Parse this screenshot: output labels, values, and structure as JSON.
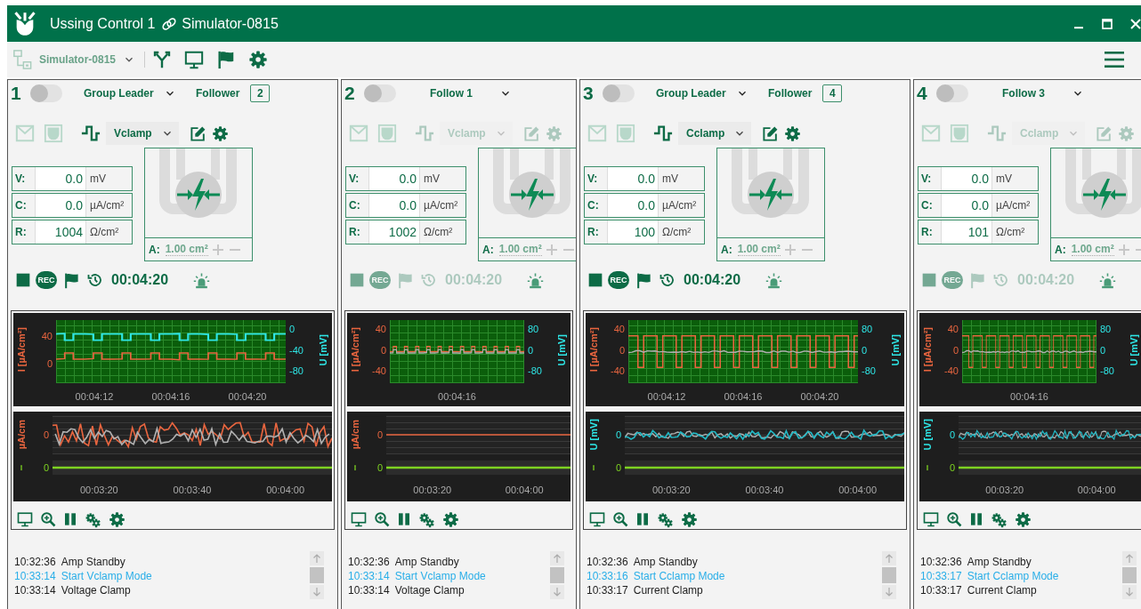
{
  "window": {
    "title": "Ussing Control 1",
    "device": "Simulator-0815"
  },
  "toolbar": {
    "device": "Simulator-0815"
  },
  "panels": [
    {
      "kind": "leader",
      "number": "1",
      "on": false,
      "group": "Group Leader",
      "follower_label": "Follower",
      "follower_count": "2",
      "controls_enabled": true,
      "mode": "Vclamp",
      "params": [
        {
          "label": "V:",
          "value": "0.0",
          "unit": "mV"
        },
        {
          "label": "C:",
          "value": "0.0",
          "unit": "µA/cm²"
        },
        {
          "label": "R:",
          "value": "1004",
          "unit": "Ω/cm²"
        }
      ],
      "area": {
        "label": "A:",
        "value": "1.00 cm²"
      },
      "rec_label": "REC",
      "time": "00:04:20",
      "trace_chart": {
        "kind": "voltage_steps",
        "left_label": "I [µA/cm²]",
        "left_ticks": [
          "40",
          "0"
        ],
        "right_label": "U [mV]",
        "right_ticks": [
          "0",
          "-40",
          "-80"
        ],
        "x_ticks": [
          "00:04:12",
          "00:04:16",
          "00:04:20"
        ]
      },
      "trend_chart": {
        "kind": "current_noise",
        "left_label": "µA/cm",
        "left_tick": "0",
        "lower_tick": "0",
        "x_ticks": [
          "00:03:20",
          "00:03:40",
          "00:04:00"
        ]
      },
      "log": [
        {
          "time": "10:32:36",
          "message": "Amp Standby",
          "color": "#1e1e1e"
        },
        {
          "time": "10:33:14",
          "message": "Start Vclamp Mode",
          "color": "#29aee8"
        },
        {
          "time": "10:33:14",
          "message": "Voltage Clamp",
          "color": "#1e1e1e"
        }
      ]
    },
    {
      "kind": "follower",
      "number": "2",
      "on": false,
      "group": "Follow 1",
      "controls_enabled": false,
      "mode": "Vclamp",
      "params": [
        {
          "label": "V:",
          "value": "0.0",
          "unit": "mV"
        },
        {
          "label": "C:",
          "value": "0.0",
          "unit": "µA/cm²"
        },
        {
          "label": "R:",
          "value": "1002",
          "unit": "Ω/cm²"
        }
      ],
      "area": {
        "label": "A:",
        "value": "1.00 cm²"
      },
      "rec_label": "REC",
      "time": "00:04:20",
      "trace_chart": {
        "kind": "small_steps",
        "left_label": "I [µA/cm²]",
        "left_ticks": [
          "40",
          "0",
          "-40"
        ],
        "right_label": "U [mV]",
        "right_ticks": [
          "80",
          "0",
          "-80"
        ],
        "x_ticks": [
          "00:04:16"
        ]
      },
      "trend_chart": {
        "kind": "current_flat",
        "left_label": "µA/cm",
        "left_tick": "0",
        "lower_tick": "0",
        "x_ticks": [
          "00:03:20",
          "00:04:00"
        ]
      },
      "log": [
        {
          "time": "10:32:36",
          "message": "Amp Standby",
          "color": "#1e1e1e"
        },
        {
          "time": "10:33:14",
          "message": "Start Vclamp Mode",
          "color": "#29aee8"
        },
        {
          "time": "10:33:14",
          "message": "Voltage Clamp",
          "color": "#1e1e1e"
        }
      ]
    },
    {
      "kind": "leader",
      "number": "3",
      "on": false,
      "group": "Group Leader",
      "follower_label": "Follower",
      "follower_count": "4",
      "controls_enabled": true,
      "mode": "Cclamp",
      "params": [
        {
          "label": "V:",
          "value": "0.0",
          "unit": "mV"
        },
        {
          "label": "C:",
          "value": "0.0",
          "unit": "µA/cm²"
        },
        {
          "label": "R:",
          "value": "100",
          "unit": "Ω/cm²"
        }
      ],
      "area": {
        "label": "A:",
        "value": "1.00 cm²"
      },
      "rec_label": "REC",
      "time": "00:04:20",
      "trace_chart": {
        "kind": "current_steps",
        "left_label": "I [µA/cm²]",
        "left_ticks": [
          "40",
          "0",
          "-40"
        ],
        "right_label": "U [mV]",
        "right_ticks": [
          "80",
          "0",
          "-80"
        ],
        "x_ticks": [
          "00:04:12",
          "00:04:16",
          "00:04:20"
        ]
      },
      "trend_chart": {
        "kind": "voltage_noise",
        "left_label": "U [mV]",
        "left_tick": "0",
        "lower_tick": "0",
        "x_ticks": [
          "00:03:20",
          "00:03:40",
          "00:04:00"
        ]
      },
      "log": [
        {
          "time": "10:32:36",
          "message": "Amp Standby",
          "color": "#1e1e1e"
        },
        {
          "time": "10:33:16",
          "message": "Start Cclamp Mode",
          "color": "#29aee8"
        },
        {
          "time": "10:33:17",
          "message": "Current Clamp",
          "color": "#1e1e1e"
        }
      ]
    },
    {
      "kind": "follower",
      "number": "4",
      "on": false,
      "group": "Follow 3",
      "controls_enabled": false,
      "mode": "Cclamp",
      "params": [
        {
          "label": "V:",
          "value": "0.0",
          "unit": "mV"
        },
        {
          "label": "C:",
          "value": "0.0",
          "unit": "µA/cm²"
        },
        {
          "label": "R:",
          "value": "101",
          "unit": "Ω/cm²"
        }
      ],
      "area": {
        "label": "A:",
        "value": "1.00 cm²"
      },
      "rec_label": "REC",
      "time": "00:04:20",
      "trace_chart": {
        "kind": "current_steps",
        "left_label": "I [µA/cm²]",
        "left_ticks": [
          "40",
          "0",
          "-40"
        ],
        "right_label": "U [mV]",
        "right_ticks": [
          "80",
          "0",
          "-80"
        ],
        "x_ticks": [
          "00:04:16"
        ]
      },
      "trend_chart": {
        "kind": "voltage_noise",
        "left_label": "U [mV]",
        "left_tick": "0",
        "lower_tick": "0",
        "x_ticks": [
          "00:03:20",
          "00:04:00"
        ]
      },
      "log": [
        {
          "time": "10:32:36",
          "message": "Amp Standby",
          "color": "#1e1e1e"
        },
        {
          "time": "10:33:17",
          "message": "Start Cclamp Mode",
          "color": "#29aee8"
        },
        {
          "time": "10:33:17",
          "message": "Current Clamp",
          "color": "#1e1e1e"
        }
      ]
    }
  ]
}
